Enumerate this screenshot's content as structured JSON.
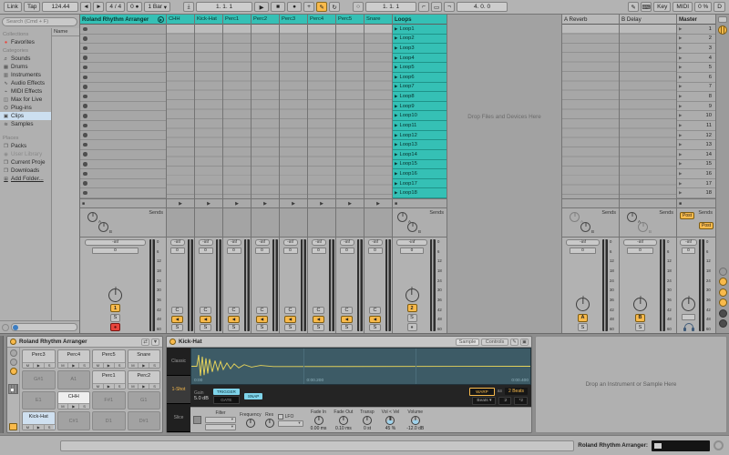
{
  "colors": {
    "track_header": "#35c0b5",
    "accent_orange": "#f9ba4b",
    "record_red": "#e8453c",
    "selected_blue": "#cfe0f0",
    "waveform_yellow": "#e6d35a"
  },
  "toolbar": {
    "link": "Link",
    "tap": "Tap",
    "tempo": "124.44",
    "nudge_back": "◄",
    "nudge_fwd": "►",
    "time_sig": "4 / 4",
    "groove": "0 ●",
    "groove_caret": "▾",
    "quantize": "1 Bar",
    "quantize_caret": "▾",
    "follow": "⤓",
    "position": "1.  1.  1",
    "play": "▶",
    "stop": "■",
    "record": "●",
    "overdub": "+",
    "automation_arm": "✎",
    "reenable": "↻",
    "loop_set": "○",
    "loop_start": "1.  1.  1",
    "punch_in": "⌐",
    "loop_switch": "▭",
    "punch_out": "¬",
    "loop_length": "4.  0.  0",
    "draw": "✎",
    "kbd": "⌨",
    "key": "Key",
    "midi": "MIDI",
    "cpu": "0 %",
    "disk": "D"
  },
  "browser": {
    "search_placeholder": "Search (Cmd + F)",
    "name_header": "Name",
    "collections_label": "Collections",
    "categories_label": "Categories",
    "places_label": "Places",
    "collections": [
      {
        "icon": "●",
        "label": "Favorites",
        "fav": true
      }
    ],
    "categories": [
      {
        "icon": "♬",
        "label": "Sounds"
      },
      {
        "icon": "▦",
        "label": "Drums"
      },
      {
        "icon": "▥",
        "label": "Instruments"
      },
      {
        "icon": "∿",
        "label": "Audio Effects"
      },
      {
        "icon": "⌁",
        "label": "MIDI Effects"
      },
      {
        "icon": "◫",
        "label": "Max for Live"
      },
      {
        "icon": "⌬",
        "label": "Plug-ins"
      },
      {
        "icon": "▣",
        "label": "Clips",
        "selected": true
      },
      {
        "icon": "≋",
        "label": "Samples"
      }
    ],
    "places": [
      {
        "icon": "❒",
        "label": "Packs"
      },
      {
        "icon": "◉",
        "label": "User Library",
        "dim": true
      },
      {
        "icon": "❒",
        "label": "Current Proje"
      },
      {
        "icon": "❒",
        "label": "Downloads"
      },
      {
        "icon": "⊞",
        "label": "Add Folder...",
        "add": true
      }
    ]
  },
  "session": {
    "group_name": "Roland Rhythm Arranger",
    "fold": "▶",
    "tracks": [
      "CHH",
      "Kick-Hat",
      "Perc1",
      "Perc2",
      "Perc3",
      "Perc4",
      "Perc5",
      "Snare"
    ],
    "loops_name": "Loops",
    "clips": [
      "Loop1",
      "Loop2",
      "Loop3",
      "Loop4",
      "Loop5",
      "Loop6",
      "Loop7",
      "Loop8",
      "Loop9",
      "Loop10",
      "Loop11",
      "Loop12",
      "Loop13",
      "Loop14",
      "Loop15",
      "Loop16",
      "Loop17",
      "Loop18"
    ],
    "returns": {
      "a": "A Reverb",
      "b": "B Delay"
    },
    "master_name": "Master",
    "scenes": [
      "1",
      "2",
      "3",
      "4",
      "5",
      "6",
      "7",
      "8",
      "9",
      "10",
      "11",
      "12",
      "13",
      "14",
      "15",
      "16",
      "17",
      "18"
    ],
    "drop_hint": "Drop Files and Devices Here",
    "clip_play": "▶",
    "stop_square": "■",
    "stop_tri": "▶",
    "toggles": [
      {
        "on": false
      },
      {
        "on": true
      },
      {
        "on": true
      },
      {
        "on": true
      },
      {
        "dark": true
      },
      {
        "dark": true
      }
    ]
  },
  "mixer": {
    "sends_label": "Sends",
    "a": "A",
    "b": "B",
    "post": "Post",
    "vol": "-inf",
    "pan": "0",
    "pan_c": "C",
    "spk": "◀",
    "solo": "S",
    "arm": "●",
    "group_no": "1",
    "loops_no": "2",
    "db": [
      "0",
      "6",
      "12",
      "18",
      "24",
      "30",
      "36",
      "42",
      "48",
      "60"
    ]
  },
  "drum_rack": {
    "title": "Roland Rhythm Arranger",
    "pad_mute": "M",
    "pad_play": "▶",
    "pad_solo": "S",
    "pads": [
      {
        "label": "Perc3",
        "filled": true
      },
      {
        "label": "Perc4",
        "filled": true
      },
      {
        "label": "Perc5",
        "filled": true
      },
      {
        "label": "Snare",
        "filled": true
      },
      {
        "label": "G#1"
      },
      {
        "label": "A1"
      },
      {
        "label": "Perc1",
        "filled": true
      },
      {
        "label": "Perc2",
        "filled": true
      },
      {
        "label": "E1"
      },
      {
        "label": "CHH",
        "filled": true,
        "lit": true
      },
      {
        "label": "F#1"
      },
      {
        "label": "G1"
      },
      {
        "label": "Kick-Hat",
        "filled": true,
        "selected": true
      },
      {
        "label": "C#1"
      },
      {
        "label": "D1"
      },
      {
        "label": "D#1"
      }
    ]
  },
  "simpler": {
    "title": "Kick-Hat",
    "tab_sample": "Sample",
    "tab_controls": "Controls",
    "edit_icon": "✎",
    "save_icon": "▣",
    "modes": [
      {
        "label": "Classic"
      },
      {
        "label": "1-Shot",
        "active": true
      },
      {
        "label": "Slice"
      }
    ],
    "time_labels": [
      "0:00",
      "0:00.200",
      "0:00.400"
    ],
    "gain_label": "Gain",
    "gain_value": "5.0 dB",
    "trigger": "TRIGGER",
    "gate": "GATE",
    "snap": "SNAP",
    "warp": "WARP",
    "as_label": "as",
    "warp_value": "2 Beats",
    "warp_mode": "Beats",
    "caret": "▾",
    "div2": ":2",
    "mul2": "*2",
    "filter_label": "Filter",
    "frequency_label": "Frequency",
    "res_label": "Res",
    "lfo_label": "LFO",
    "knobs": [
      {
        "label": "Fade In",
        "value": "0.00 ms"
      },
      {
        "label": "Fade Out",
        "value": "0.10 ms"
      },
      {
        "label": "Transp",
        "value": "0 st"
      },
      {
        "label": "Vol < Vel",
        "value": "45 %",
        "blue": true
      },
      {
        "label": "Volume",
        "value": "-12.0 dB",
        "blue": true
      }
    ]
  },
  "device_drop_hint": "Drop an Instrument or Sample Here",
  "status_bar": {
    "device_label": "Roland Rhythm Arranger:"
  }
}
